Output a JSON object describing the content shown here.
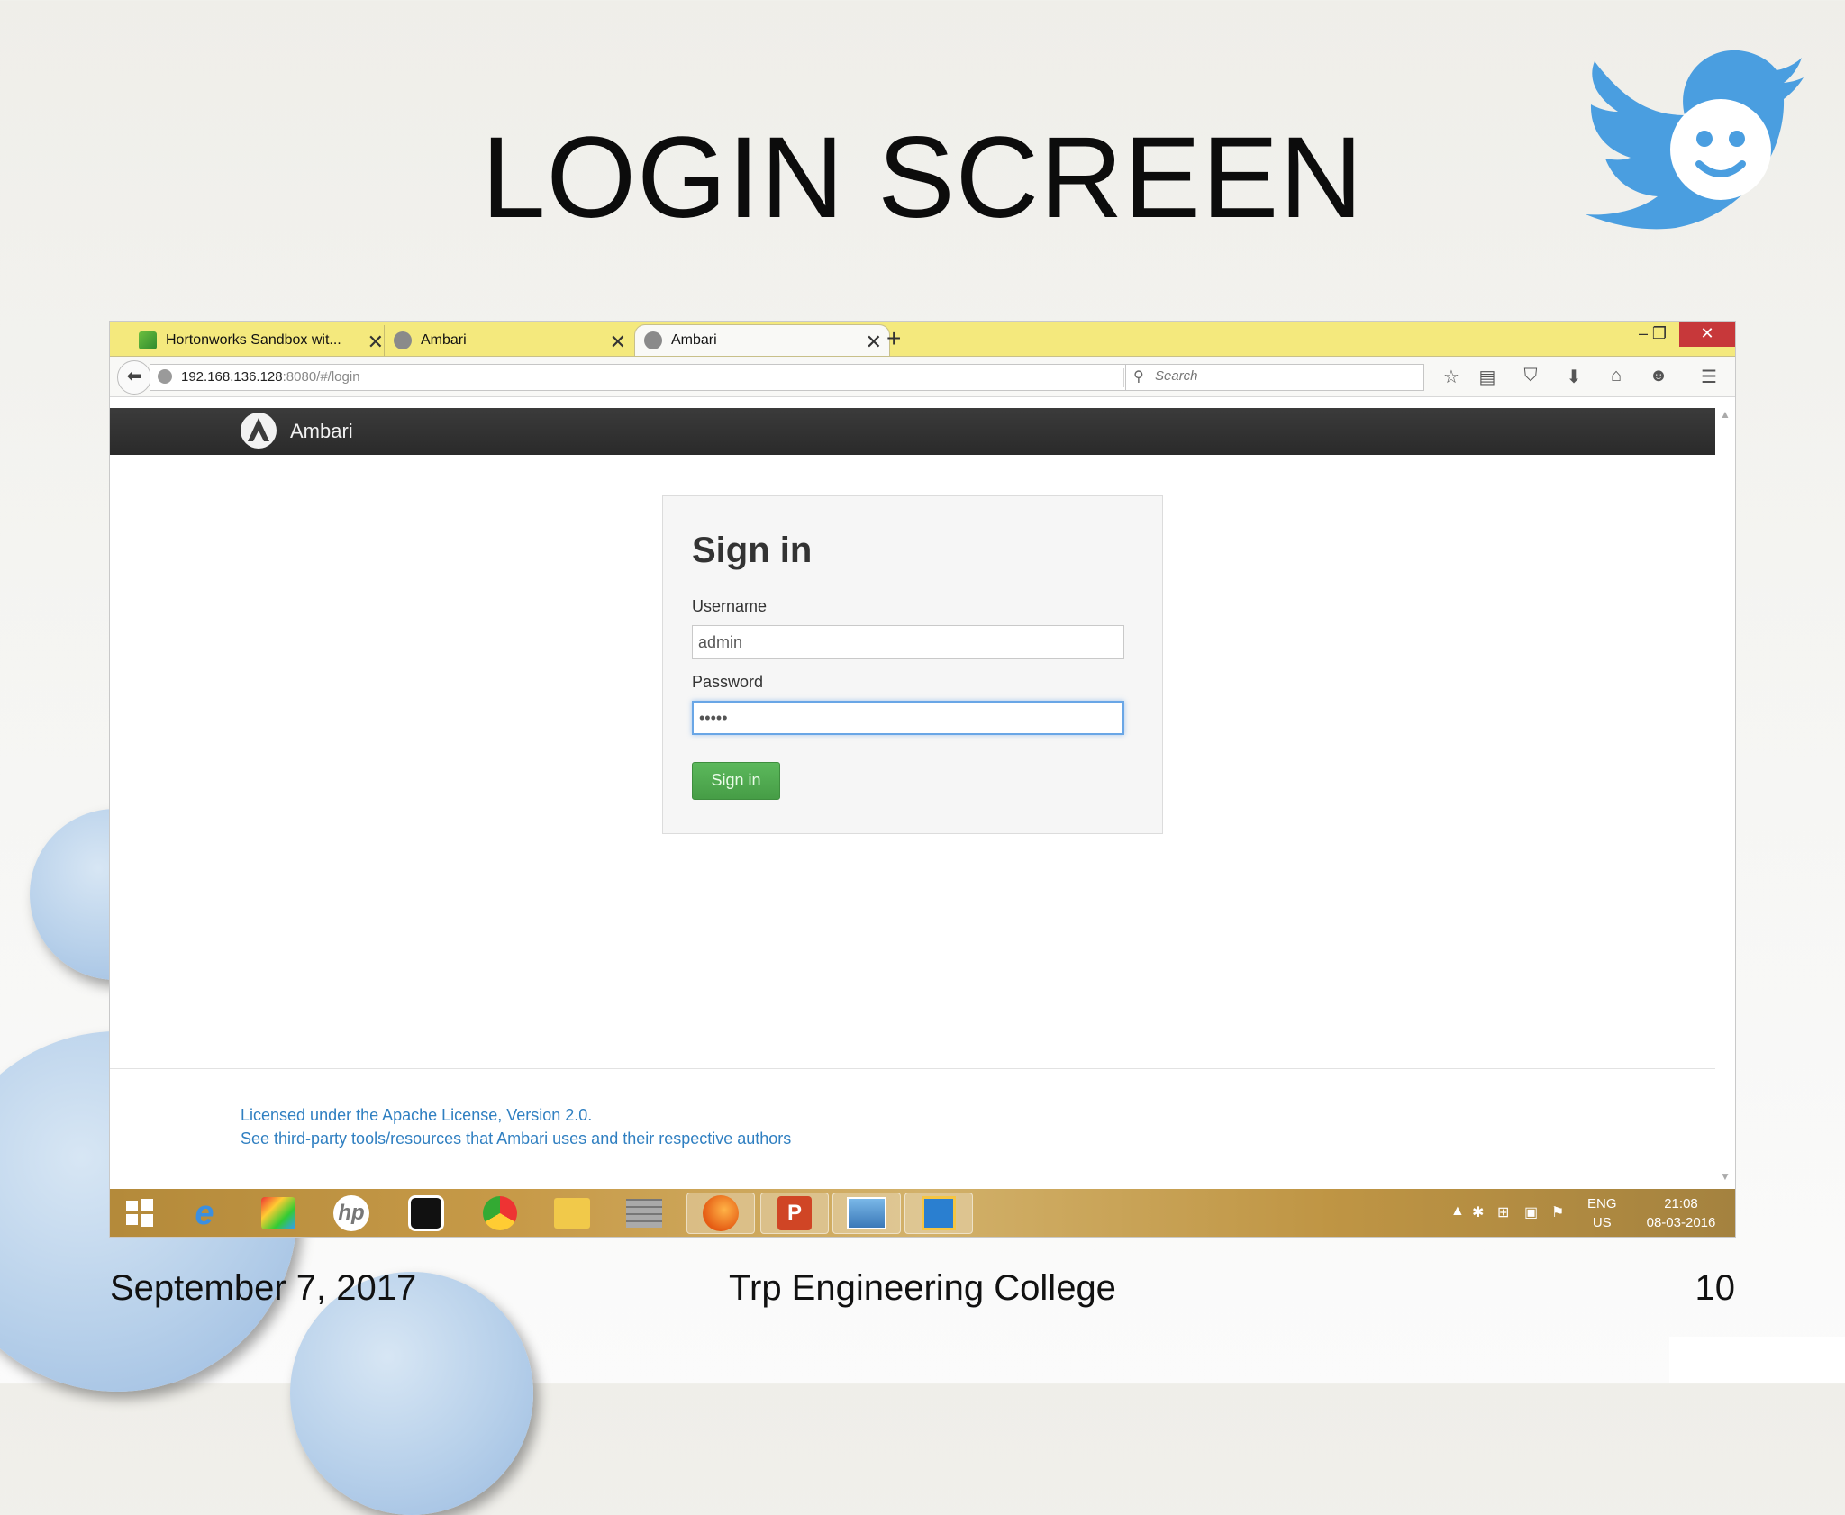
{
  "slide": {
    "title": "LOGIN SCREEN",
    "footer_date": "September 7, 2017",
    "footer_college": "Trp Engineering College",
    "page_number": "10"
  },
  "browser": {
    "tabs": [
      {
        "label": "Hortonworks Sandbox wit..."
      },
      {
        "label": "Ambari"
      },
      {
        "label": "Ambari"
      }
    ],
    "new_tab": "+",
    "url_host": "192.168.136.128",
    "url_rest": ":8080/#/login",
    "search_placeholder": "Search",
    "window_controls": {
      "minimize": "–",
      "restore": "❐",
      "close": "✕"
    }
  },
  "app": {
    "brand": "Ambari",
    "login": {
      "heading": "Sign in",
      "username_label": "Username",
      "username_value": "admin",
      "password_label": "Password",
      "password_value": "•••••",
      "submit_label": "Sign in"
    },
    "footer": {
      "license": "Licensed under the Apache License, Version 2.0.",
      "third_party": "See third-party tools/resources that Ambari uses and their respective authors"
    }
  },
  "taskbar": {
    "lang_top": "ENG",
    "lang_bottom": "US",
    "time": "21:08",
    "date": "08-03-2016",
    "icons": [
      "windows-start-icon",
      "ie-icon",
      "paint-icon",
      "hp-icon",
      "camera-icon",
      "chrome-icon",
      "explorer-icon",
      "firewall-icon",
      "firefox-icon",
      "powerpoint-icon",
      "photos-icon",
      "virtualbox-icon"
    ]
  },
  "colors": {
    "tab_bar": "#f4e97d",
    "app_header": "#333333",
    "button_green": "#5cb85c",
    "link_blue": "#2f7fc1",
    "close_red": "#c7383a",
    "bird_blue": "#4a9ee0"
  }
}
